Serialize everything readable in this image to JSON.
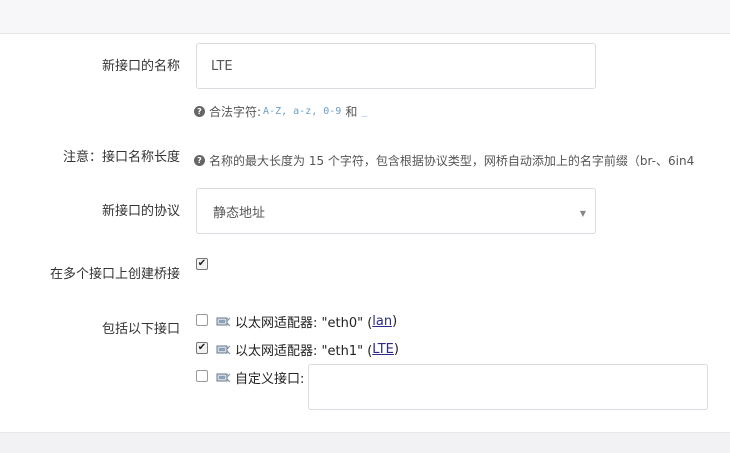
{
  "form": {
    "name_label": "新接口的名称",
    "name_value": "LTE",
    "name_hint_prefix": "合法字符:",
    "name_hint_chars": "A-Z, a-z, 0-9",
    "name_hint_and": "和",
    "name_hint_underscore": "_",
    "note_label": "注意：接口名称长度",
    "note_text": "名称的最大长度为 15 个字符，包含根据协议类型，网桥自动添加上的名字前缀（br-、6in4",
    "protocol_label": "新接口的协议",
    "protocol_value": "静态地址",
    "bridge_label": "在多个接口上创建桥接",
    "bridge_checked": true,
    "include_label": "包括以下接口",
    "interfaces": [
      {
        "prefix": "以太网适配器: \"eth0\" (",
        "link": "lan",
        "suffix": ")",
        "checked": false
      },
      {
        "prefix": "以太网适配器: \"eth1\" (",
        "link": "LTE",
        "suffix": ")",
        "checked": true
      }
    ],
    "custom_label": "自定义接口:",
    "custom_value": ""
  },
  "icons": {
    "help": "question-circle-icon",
    "nic": "ethernet-adapter-icon",
    "caret": "caret-down-icon"
  },
  "colors": {
    "link": "#2a2a8c",
    "hint_code": "#6a9dc7",
    "border": "#d9dde3"
  }
}
